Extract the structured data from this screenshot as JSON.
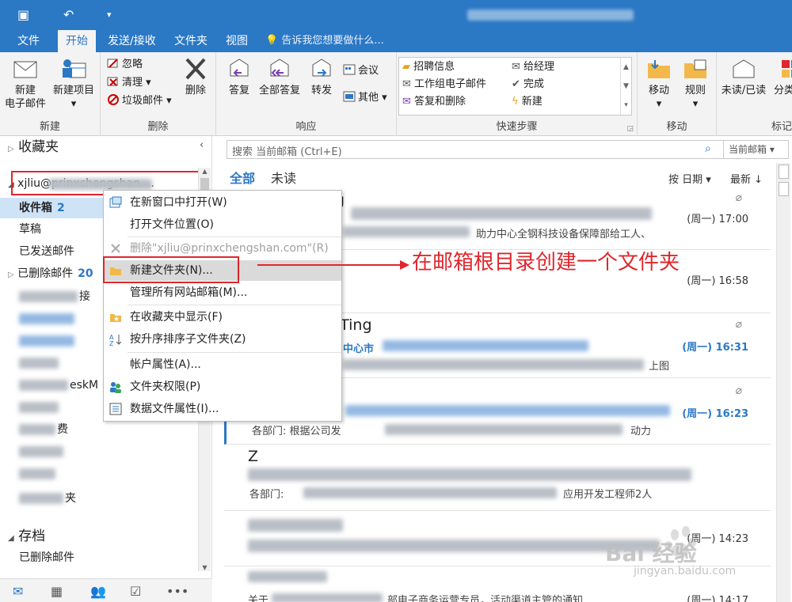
{
  "menu": {
    "tabs": [
      "文件",
      "开始",
      "发送/接收",
      "文件夹",
      "视图"
    ],
    "active_tab": "开始",
    "tell_me": "告诉我您想要做什么..."
  },
  "ribbon": {
    "new_group": {
      "label": "新建",
      "new_mail_1": "新建",
      "new_mail_2": "电子邮件",
      "new_items": "新建项目"
    },
    "delete_group": {
      "label": "删除",
      "ignore": "忽略",
      "cleanup": "清理",
      "junk": "垃圾邮件",
      "delete": "删除"
    },
    "respond_group": {
      "label": "响应",
      "reply": "答复",
      "reply_all": "全部答复",
      "forward": "转发",
      "meeting": "会议",
      "more": "其他"
    },
    "quicksteps_group": {
      "label": "快速步骤",
      "items": [
        "招聘信息",
        "工作组电子邮件",
        "答复和删除",
        "给经理",
        "完成",
        "新建"
      ]
    },
    "move_group": {
      "label": "移动",
      "move": "移动",
      "rules": "规则"
    },
    "tags_group": {
      "label": "标记",
      "unread_read": "未读/已读",
      "categorize": "分类"
    }
  },
  "nav": {
    "favorites": "收藏夹",
    "account": "xjliu@prinxchengshan....",
    "inbox": "收件箱",
    "inbox_count": "2",
    "drafts": "草稿",
    "sent": "已发送邮件",
    "deleted": "已删除邮件",
    "deleted_count": "20",
    "partial_1": "接",
    "partial_2": "eskM",
    "partial_3": "费",
    "partial_4": "夹",
    "archive": "存档",
    "archive_deleted": "已删除邮件"
  },
  "search": {
    "placeholder": "搜索 当前邮箱 (Ctrl+E)",
    "scope": "当前邮箱"
  },
  "filter": {
    "all": "全部",
    "unread": "未读",
    "sort_by": "按 日期",
    "order": "最新 ↓"
  },
  "mails": [
    {
      "sender": "ng",
      "time": "(周一) 17:00",
      "preview": "助力中心全钢科技设备保障部给工人、"
    },
    {
      "sender": "",
      "time": "(周一) 16:58",
      "preview": ""
    },
    {
      "sender": "g Ting",
      "time": "(周一) 16:31",
      "preview": "中心市",
      "preview2": "上图"
    },
    {
      "sender": "g",
      "time": "(周一) 16:23",
      "preview": "各部门:  根据公司发",
      "preview2": "动力"
    },
    {
      "sender": "Z",
      "time": "",
      "preview": "各部门:",
      "preview2": "应用开发工程师2人"
    },
    {
      "sender": "",
      "time": "(周一) 14:23",
      "preview": ""
    },
    {
      "sender": "",
      "time": "(周一) 14:17",
      "preview": "关于",
      "preview2": "部电子商务运营专员，活动渠道主管的通知"
    }
  ],
  "context_menu": {
    "open_new_window": "在新窗口中打开(W)",
    "open_file_location": "打开文件位置(O)",
    "delete": "删除\"xjliu@prinxchengshan.com\"(R)",
    "new_folder": "新建文件夹(N)...",
    "manage_mailboxes": "管理所有网站邮箱(M)...",
    "show_in_favorites": "在收藏夹中显示(F)",
    "sort_subfolders": "按升序排序子文件夹(Z)",
    "account_props": "帐户属性(A)...",
    "folder_perms": "文件夹权限(P)",
    "data_file_props": "数据文件属性(I)..."
  },
  "annotation": "在邮箱根目录创建一个文件夹",
  "watermark": {
    "brand": "Bai 经验",
    "url": "jingyan.baidu.com"
  },
  "colors": {
    "accent": "#2b78c5",
    "annotation": "#e0262b",
    "selection": "#cfe3f7"
  }
}
